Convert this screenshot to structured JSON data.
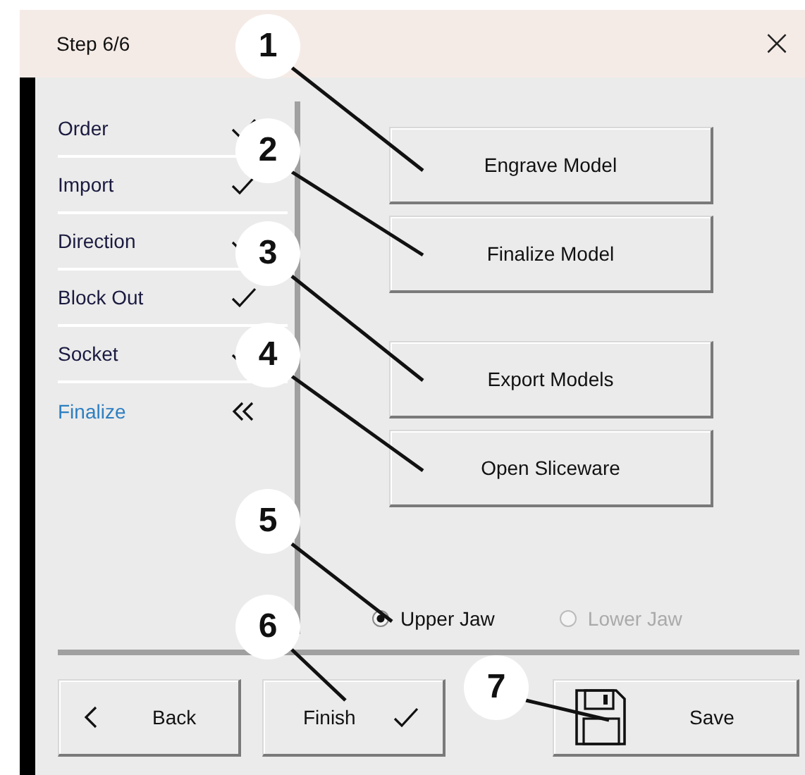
{
  "window": {
    "title": "Step 6/6",
    "close": "×"
  },
  "steps": [
    {
      "label": "Order",
      "current": false
    },
    {
      "label": "Import",
      "current": false
    },
    {
      "label": "Direction",
      "current": false
    },
    {
      "label": "Block Out",
      "current": false
    },
    {
      "label": "Socket",
      "current": false
    },
    {
      "label": "Finalize",
      "current": true
    }
  ],
  "actions": [
    "Engrave Model",
    "Finalize Model",
    "Export Models",
    "Open Sliceware"
  ],
  "jaw": [
    {
      "label": "Upper Jaw",
      "selected": true,
      "disabled": false
    },
    {
      "label": "Lower Jaw",
      "selected": false,
      "disabled": true
    }
  ],
  "footer": [
    {
      "label": "Back",
      "kind": "back"
    },
    {
      "label": "Finish",
      "kind": "finish"
    },
    {
      "label": "Save",
      "kind": "save"
    }
  ],
  "callouts": [
    "1",
    "2",
    "3",
    "4",
    "5",
    "6",
    "7"
  ]
}
